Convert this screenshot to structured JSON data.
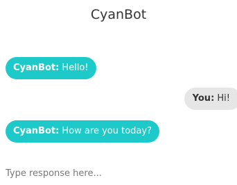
{
  "header": {
    "title": "CyanBot"
  },
  "colors": {
    "bot_bubble": "#1ec9c9",
    "user_bubble": "#e6e6e6"
  },
  "messages": [
    {
      "sender": "CyanBot:",
      "text": " Hello!",
      "role": "bot"
    },
    {
      "sender": "You:",
      "text": " Hi!",
      "role": "user"
    },
    {
      "sender": "CyanBot:",
      "text": " How are you today?",
      "role": "bot"
    }
  ],
  "composer": {
    "placeholder": "Type response here...",
    "value": ""
  }
}
